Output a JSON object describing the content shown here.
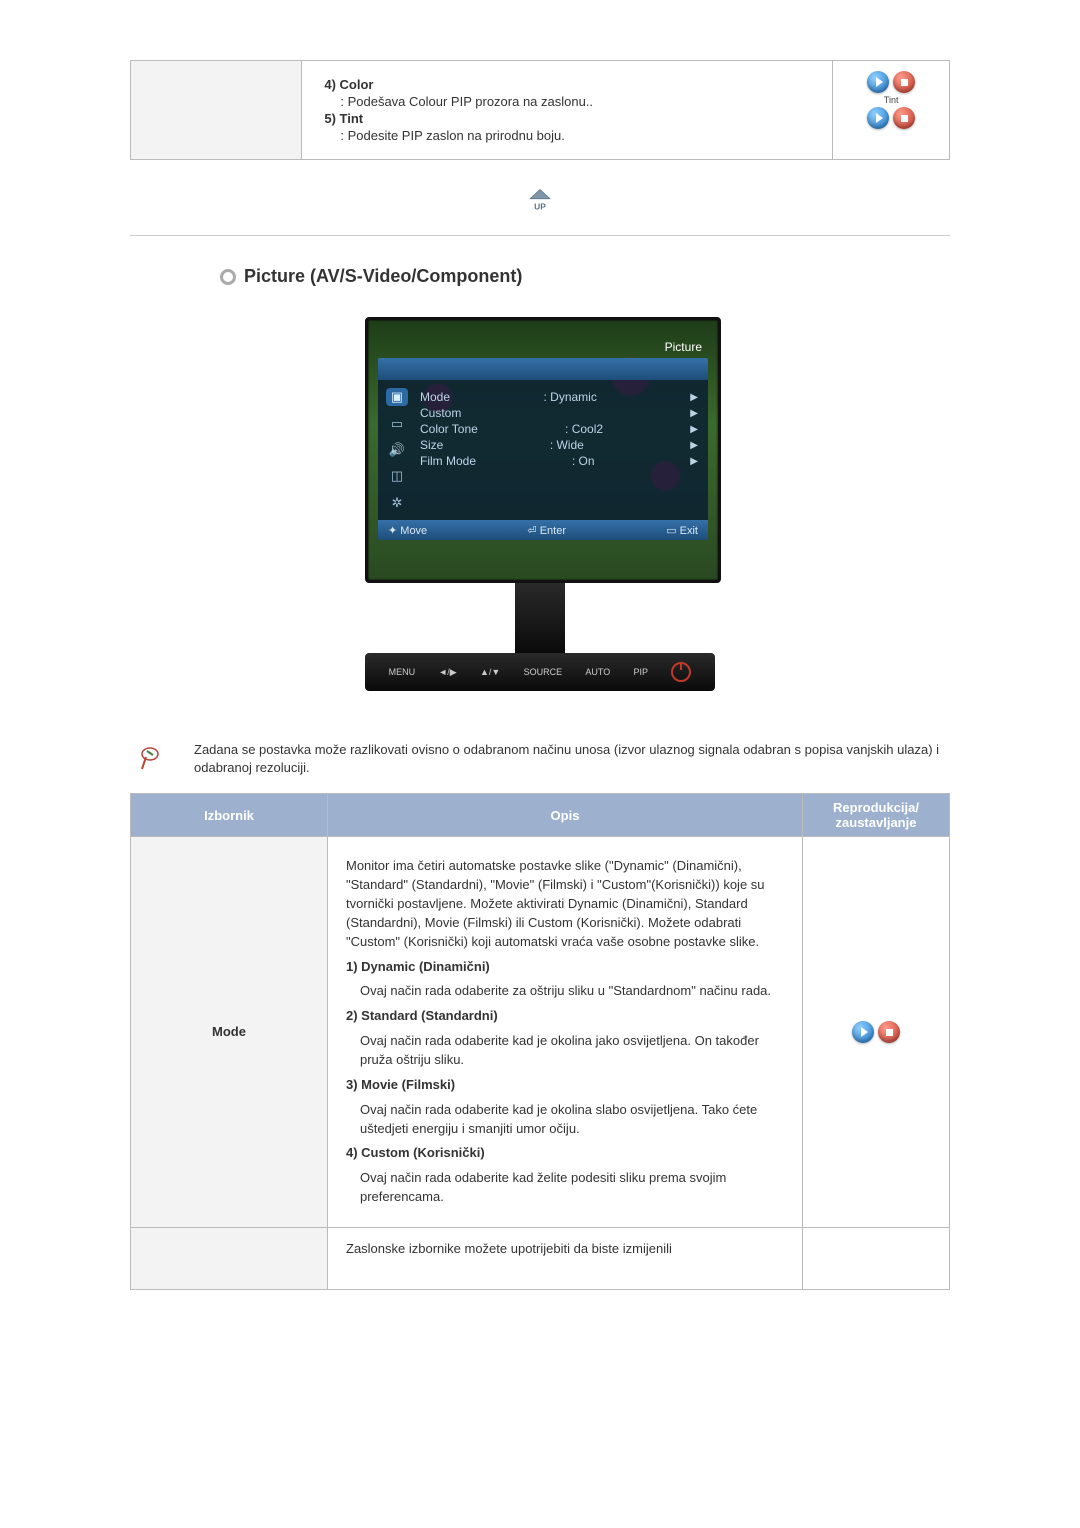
{
  "top_fragment": {
    "item4": {
      "num_label": "4) Color",
      "desc": ": Podešava Colour PIP prozora na zaslonu.."
    },
    "item5": {
      "num_label": "5) Tint",
      "desc": ": Podesite PIP zaslon na prirodnu boju."
    },
    "tint_label": "Tint"
  },
  "section": {
    "title": "Picture (AV/S-Video/Component)"
  },
  "osd": {
    "header": "Picture",
    "rows": {
      "r0": {
        "label": "Mode",
        "value": ": Dynamic"
      },
      "r1": {
        "label": "Custom",
        "value": ""
      },
      "r2": {
        "label": "Color Tone",
        "value": ": Cool2"
      },
      "r3": {
        "label": "Size",
        "value": ": Wide"
      },
      "r4": {
        "label": "Film Mode",
        "value": ": On"
      }
    },
    "footer": {
      "move": "Move",
      "enter": "Enter",
      "exit": "Exit"
    }
  },
  "monitor_buttons": {
    "menu": "MENU",
    "b2": "◄/▶",
    "b3": "▲/▼",
    "source": "SOURCE",
    "auto": "AUTO",
    "pip": "PIP"
  },
  "note": "Zadana se postavka može razlikovati ovisno o odabranom načinu unosa (izvor ulaznog signala odabran s popisa vanjskih ulaza) i odabranoj rezoluciji.",
  "table": {
    "headers": {
      "menu": "Izbornik",
      "desc": "Opis",
      "play": "Reprodukcija/ zaustavljanje"
    },
    "mode": {
      "label": "Mode",
      "intro": "Monitor ima četiri automatske postavke slike (\"Dynamic\" (Dinamični), \"Standard\" (Standardni), \"Movie\" (Filmski) i \"Custom\"(Korisnički)) koje su tvornički postavljene. Možete aktivirati Dynamic (Dinamični), Standard (Standardni), Movie (Filmski) ili Custom (Korisnički). Možete odabrati \"Custom\" (Korisnički) koji automatski vraća vaše osobne postavke slike.",
      "i1": {
        "title": "1) Dynamic (Dinamični)",
        "body": "Ovaj način rada odaberite za oštriju sliku u \"Standardnom\" načinu rada."
      },
      "i2": {
        "title": "2) Standard (Standardni)",
        "body": "Ovaj način rada odaberite kad je okolina jako osvijetljena. On također pruža oštriju sliku."
      },
      "i3": {
        "title": "3) Movie (Filmski)",
        "body": "Ovaj način rada odaberite kad je okolina slabo osvijetljena. Tako ćete uštedjeti energiju i smanjiti umor očiju."
      },
      "i4": {
        "title": "4) Custom (Korisnički)",
        "body": "Ovaj način rada odaberite kad želite podesiti sliku prema svojim preferencama."
      }
    },
    "last_partial": "Zaslonske izbornike možete upotrijebiti da biste izmijenili"
  }
}
